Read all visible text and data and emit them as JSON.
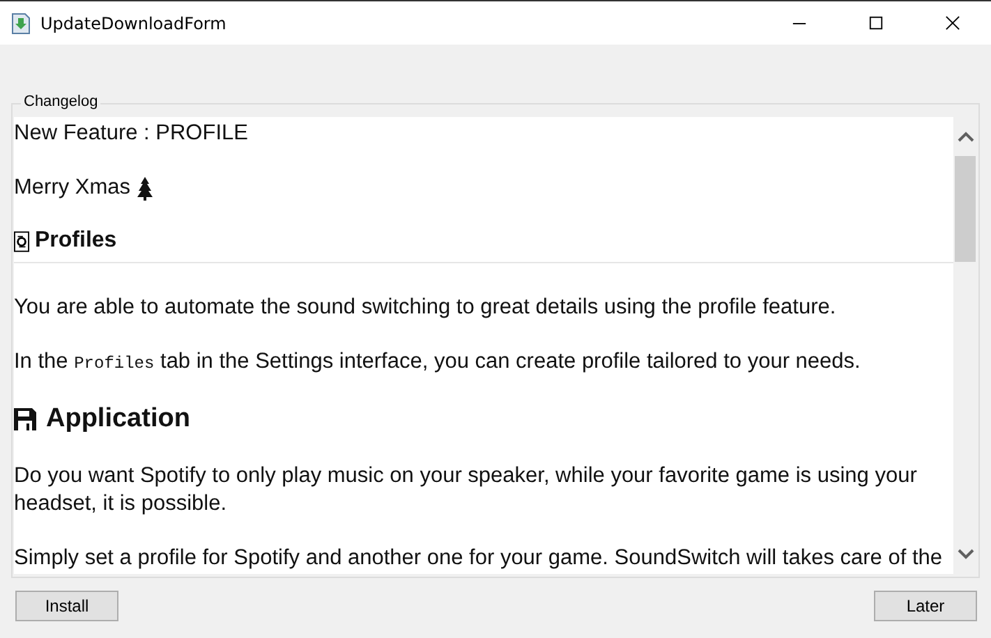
{
  "window": {
    "title": "UpdateDownloadForm"
  },
  "changelog": {
    "label": "Changelog",
    "blocks": [
      {
        "kind": "paragraph",
        "text": "New Feature : PROFILE"
      },
      {
        "kind": "paragraph",
        "text": "Merry Xmas"
      },
      {
        "kind": "heading",
        "text": "Profiles"
      },
      {
        "kind": "paragraph",
        "text": "You are able to automate the sound switching to great details using the profile feature."
      },
      {
        "kind": "paragraph",
        "parts": [
          {
            "text": "In the "
          },
          {
            "text": "Profiles",
            "code": true
          },
          {
            "text": " tab in the Settings interface, you can create profile tailored to your needs."
          }
        ]
      },
      {
        "kind": "heading2",
        "text": "Application"
      },
      {
        "kind": "paragraph",
        "text": "Do you want Spotify to only play music on your speaker, while your favorite game is using your headset, it is possible."
      },
      {
        "kind": "paragraph",
        "text": "Simply set a profile for Spotify and another one for your game. SoundSwitch will takes care of the"
      }
    ]
  },
  "buttons": [
    {
      "label": "Install"
    },
    {
      "label": "Later"
    }
  ]
}
